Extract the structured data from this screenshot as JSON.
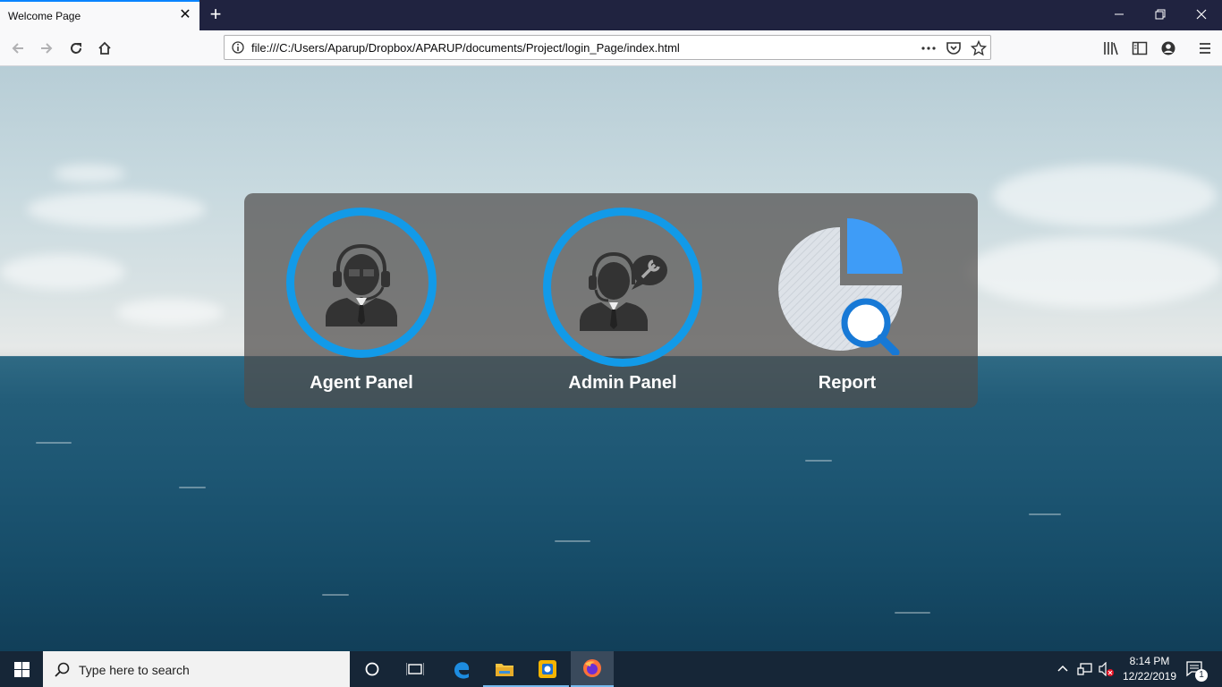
{
  "browser": {
    "tab_title": "Welcome Page",
    "tab_close": "✕",
    "new_tab": "+",
    "url": "file:///C:/Users/Aparup/Dropbox/APARUP/documents/Project/login_Page/index.html",
    "window_controls": {
      "minimize": "—",
      "restore": "❐",
      "close": "✕"
    },
    "nav_icons": [
      "back-icon",
      "forward-icon",
      "reload-icon",
      "home-icon"
    ],
    "toolbar_icons": [
      "library-icon",
      "sidebar-icon",
      "account-icon",
      "menu-icon"
    ],
    "url_actions": [
      "more-icon",
      "pocket-icon",
      "star-icon"
    ]
  },
  "page": {
    "cards": [
      {
        "label": "Agent Panel",
        "icon": "agent-icon"
      },
      {
        "label": "Admin Panel",
        "icon": "admin-icon"
      },
      {
        "label": "Report",
        "icon": "report-icon"
      }
    ],
    "colors": {
      "ring": "#129ae8",
      "panel": "#504e4c",
      "report_blue": "#3e9cf7",
      "report_grey": "#dfe3e8"
    }
  },
  "taskbar": {
    "search_placeholder": "Type here to search",
    "pinned_icons": [
      "cortana-icon",
      "task-view-icon",
      "edge-icon",
      "file-explorer-icon",
      "store-app-icon",
      "firefox-icon"
    ],
    "time": "8:14 PM",
    "date": "12/22/2019",
    "notification_count": "1"
  }
}
